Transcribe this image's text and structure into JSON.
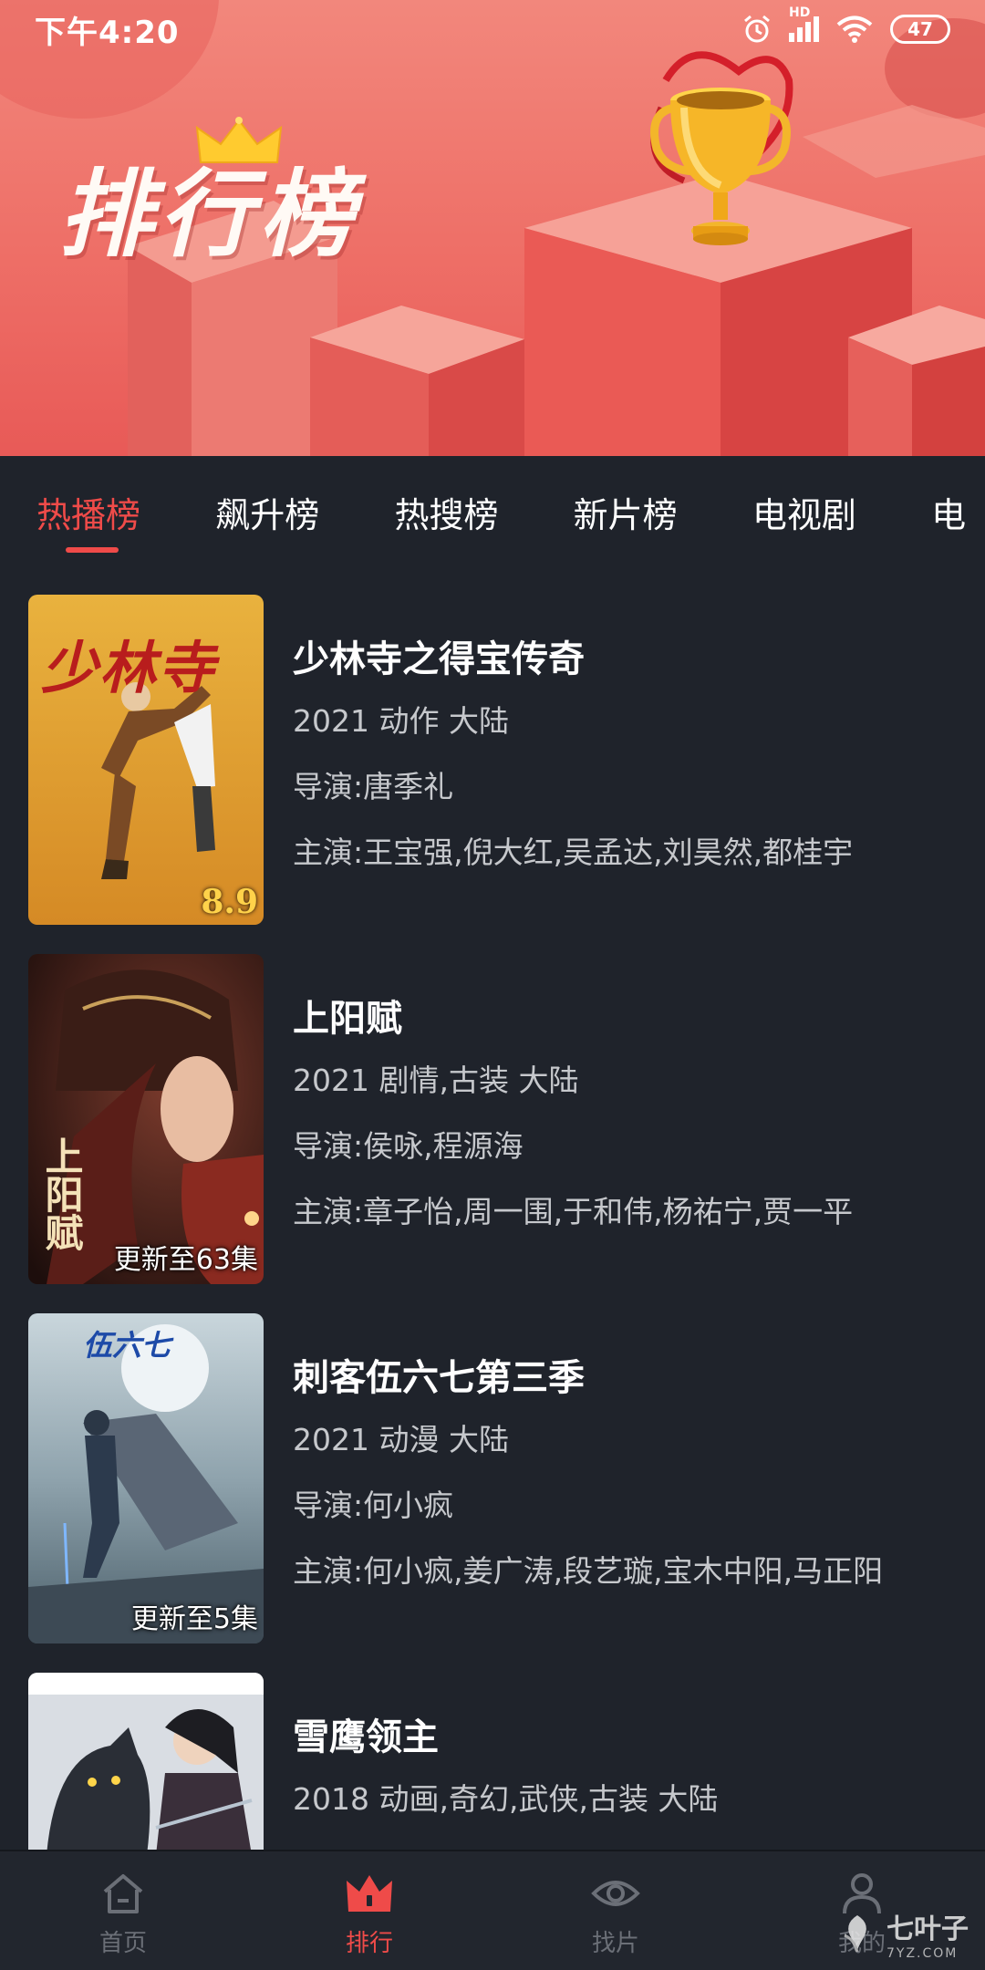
{
  "status_bar": {
    "time": "下午4:20",
    "battery": "47",
    "network": "HD"
  },
  "banner": {
    "title": "排行榜"
  },
  "tabs": [
    {
      "label": "热播榜",
      "active": true
    },
    {
      "label": "飙升榜",
      "active": false
    },
    {
      "label": "热搜榜",
      "active": false
    },
    {
      "label": "新片榜",
      "active": false
    },
    {
      "label": "电视剧",
      "active": false
    },
    {
      "label": "电",
      "active": false
    }
  ],
  "items": [
    {
      "title": "少林寺之得宝传奇",
      "meta": "2021 动作 大陆",
      "director": "导演:唐季礼",
      "cast": "主演:王宝强,倪大红,吴孟达,刘昊然,都桂宇",
      "badge": "",
      "score": "8.9",
      "poster_text": "少林寺"
    },
    {
      "title": "上阳赋",
      "meta": "2021 剧情,古装 大陆",
      "director": "导演:侯咏,程源海",
      "cast": "主演:章子怡,周一围,于和伟,杨祐宁,贾一平",
      "badge": "更新至63集",
      "score": "",
      "poster_text": "上阳赋"
    },
    {
      "title": "刺客伍六七第三季",
      "meta": "2021 动漫 大陆",
      "director": "导演:何小疯",
      "cast": "主演:何小疯,姜广涛,段艺璇,宝木中阳,马正阳",
      "badge": "更新至5集",
      "score": "",
      "poster_text": "伍六七"
    },
    {
      "title": "雪鹰领主",
      "meta": "2018 动画,奇幻,武侠,古装 大陆",
      "director": "",
      "cast": "",
      "badge": "",
      "score": "",
      "poster_text": ""
    }
  ],
  "bottom_nav": [
    {
      "label": "首页",
      "icon": "home-icon",
      "active": false
    },
    {
      "label": "排行",
      "icon": "ranking-crown-icon",
      "active": true
    },
    {
      "label": "找片",
      "icon": "eye-icon",
      "active": false
    },
    {
      "label": "我的",
      "icon": "user-icon",
      "active": false
    }
  ],
  "watermark": {
    "text": "七叶子",
    "sub": "7YZ.COM"
  },
  "colors": {
    "accent": "#ef4b49",
    "background": "#1f232b",
    "banner": "#ee6f67",
    "secondary_text": "#c6c8cc"
  }
}
